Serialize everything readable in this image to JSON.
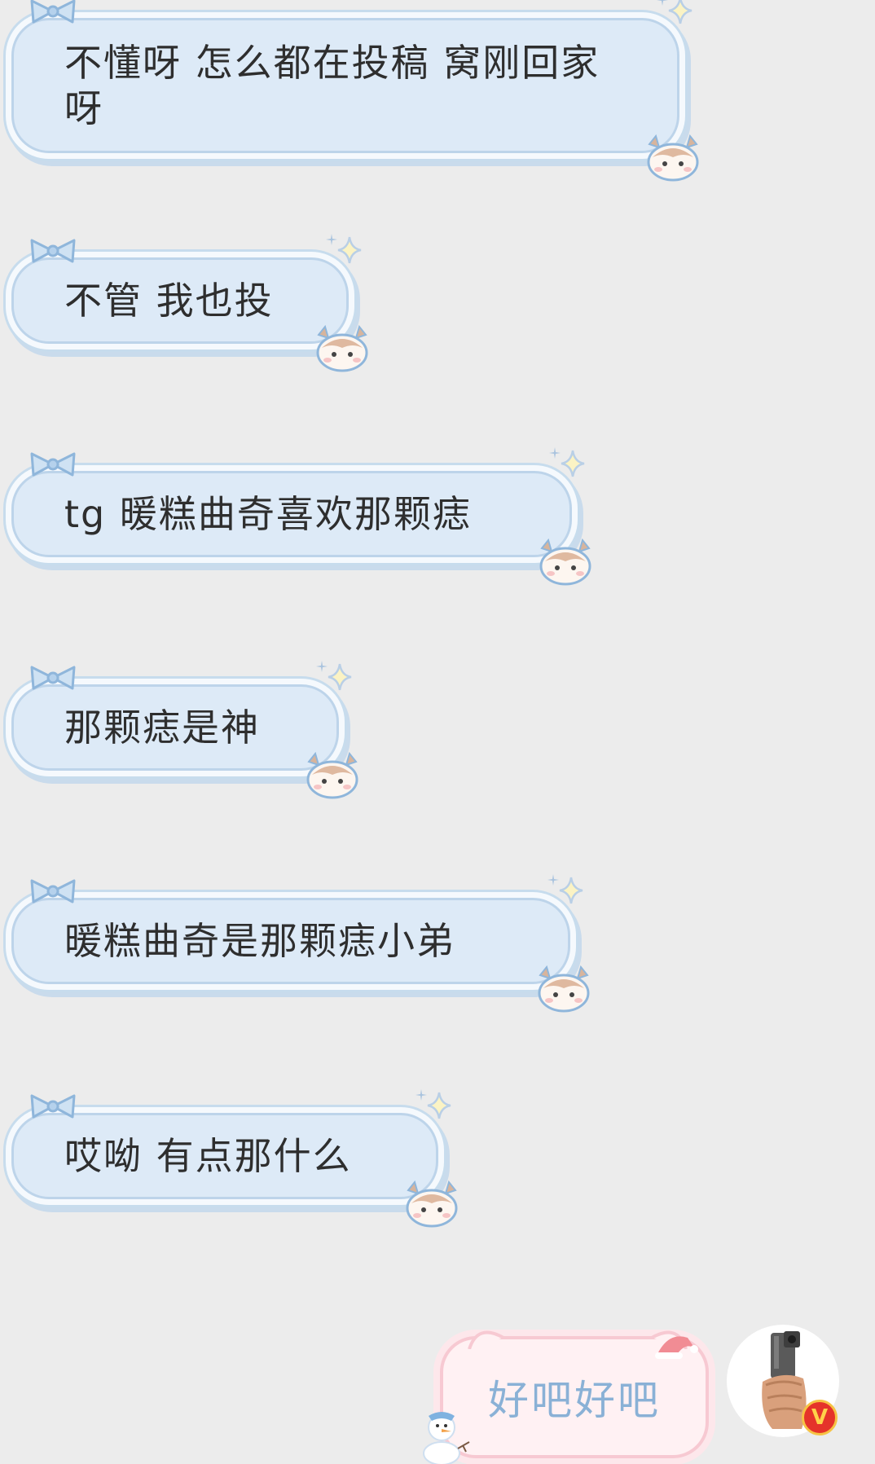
{
  "messages": [
    {
      "text": "不懂呀 怎么都在投稿 窝刚回家呀"
    },
    {
      "text": "不管 我也投"
    },
    {
      "text": "tg 暖糕曲奇喜欢那颗痣"
    },
    {
      "text": "那颗痣是神"
    },
    {
      "text": "暖糕曲奇是那颗痣小弟"
    },
    {
      "text": "哎呦 有点那什么"
    }
  ],
  "outgoing": {
    "text": "好吧好吧"
  },
  "avatar": {
    "icon": "pistol-hand-avatar-icon",
    "badge": "V",
    "badge_color": "#e5332a"
  },
  "colors": {
    "bubble_fill": "#ddeaf7",
    "bubble_border": "#bdd4ea",
    "out_fill": "#fff1f3",
    "out_text": "#8ab1d6"
  }
}
